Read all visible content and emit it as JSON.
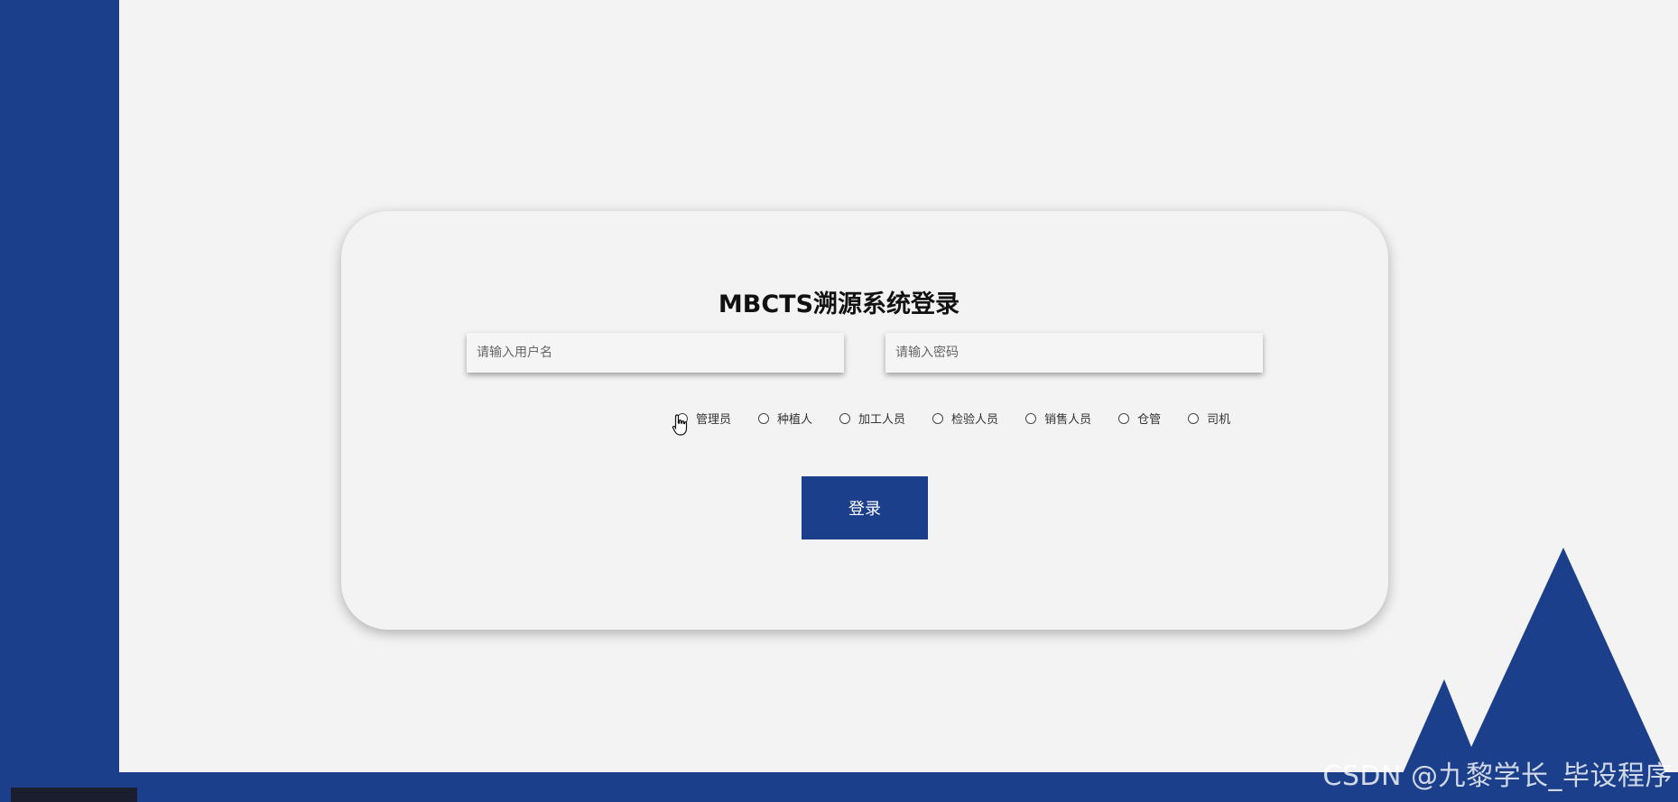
{
  "login": {
    "title": "MBCTS溯源系统登录",
    "username_placeholder": "请输入用户名",
    "password_placeholder": "请输入密码",
    "login_label": "登录"
  },
  "roles": [
    {
      "label": "管理员"
    },
    {
      "label": "种植人"
    },
    {
      "label": "加工人员"
    },
    {
      "label": "检验人员"
    },
    {
      "label": "销售人员"
    },
    {
      "label": "仓管"
    },
    {
      "label": "司机"
    }
  ],
  "watermark": "CSDN @九黎学长_毕设程序",
  "colors": {
    "brand": "#1b3f8b",
    "background": "#f3f3f3"
  },
  "icons": {
    "cursor": "hand-pointer-icon",
    "decoration": "mountain-icon"
  }
}
